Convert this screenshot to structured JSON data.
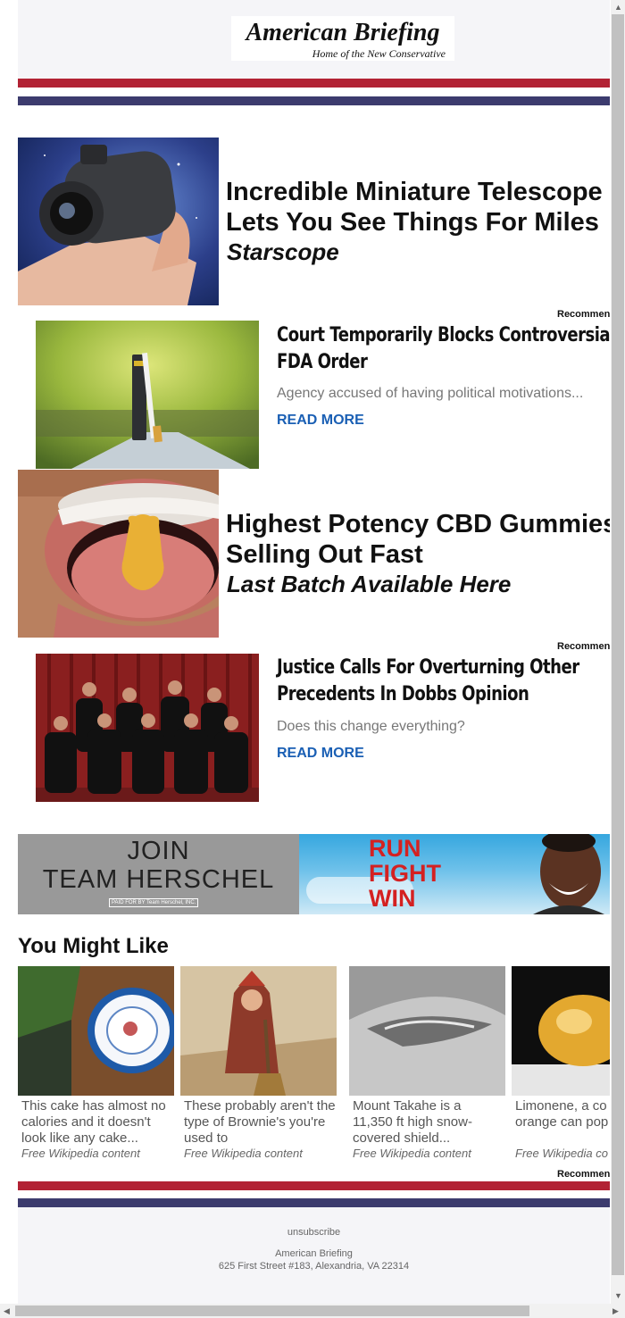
{
  "header": {
    "logo_title": "American Briefing",
    "logo_tagline": "Home of the New Conservative"
  },
  "ad1": {
    "headline_line1": "Incredible Miniature Telescope",
    "headline_line2": "Lets You See Things For Miles",
    "brand": "Starscope"
  },
  "recommended_label": "Recommended",
  "story1": {
    "title_line1": "Court Temporarily Blocks Controversial",
    "title_line2": "FDA Order",
    "description": "Agency accused of having political motivations...",
    "read_more": "READ MORE"
  },
  "ad2": {
    "headline_line1": "Highest Potency CBD Gummies",
    "headline_line2": "Selling Out Fast",
    "cta": "Last Batch Available Here"
  },
  "story2": {
    "title_line1": "Justice Calls For Overturning Other",
    "title_line2": "Precedents In Dobbs Opinion",
    "description": "Does this change everything?",
    "read_more": "READ MORE"
  },
  "banner": {
    "join_line1": "JOIN",
    "join_line2": "TEAM HERSCHEL",
    "paid_for": "PAID FOR BY Team Herschel, INC.",
    "slogan_line1": "RUN",
    "slogan_line2": "FIGHT",
    "slogan_line3": "WIN"
  },
  "you_might_like": {
    "title": "You Might Like",
    "cards": [
      {
        "text": "This cake has almost no calories and it doesn't look like any cake...",
        "source": "Free Wikipedia content"
      },
      {
        "text": "These probably aren't the type of Brownie's you're used to",
        "source": "Free Wikipedia content"
      },
      {
        "text": "Mount Takahe is a 11,350 ft high snow-covered shield...",
        "source": "Free Wikipedia content"
      },
      {
        "text": "Limonene, a co found in orange can pop a balloo",
        "source": "Free Wikipedia co"
      }
    ]
  },
  "footer": {
    "unsubscribe": "unsubscribe",
    "company": "American Briefing",
    "address": "625 First Street #183, Alexandria, VA 22314"
  }
}
